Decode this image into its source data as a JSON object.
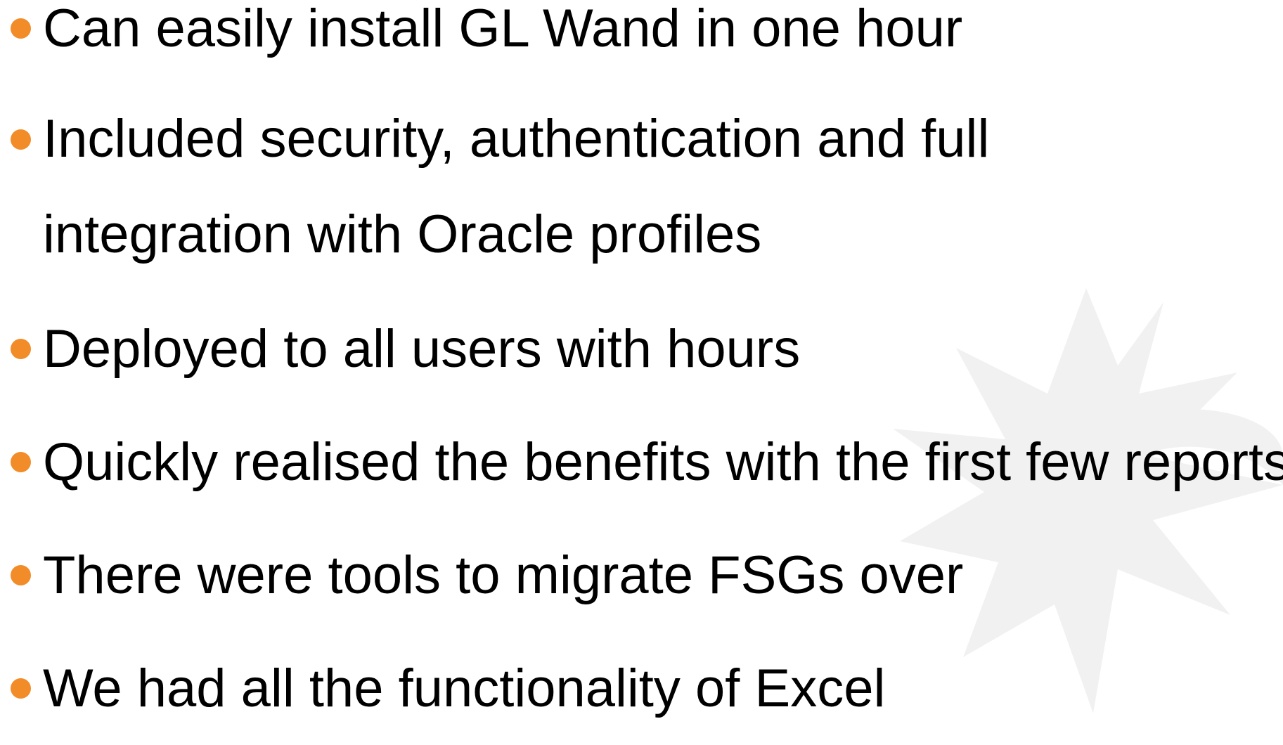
{
  "slide": {
    "accent_color": "#f28c28",
    "watermark_color": "#f1f1f1",
    "bullets": [
      {
        "text": "Can easily install GL Wand in one hour"
      },
      {
        "text": "Included security, authentication and full integration with Oracle profiles"
      },
      {
        "text": "Deployed to all users with hours"
      },
      {
        "text": "Quickly realised the benefits with the first few reports"
      },
      {
        "text": "There were tools to migrate FSGs over"
      },
      {
        "text": "We had all the functionality of Excel"
      }
    ]
  }
}
